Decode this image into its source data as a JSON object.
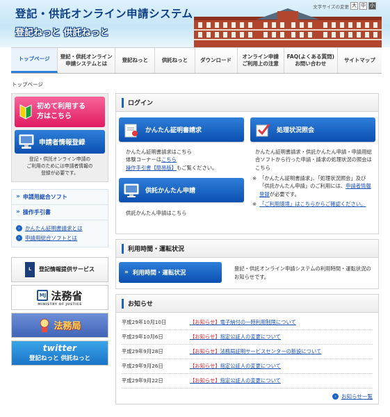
{
  "header": {
    "title": "登記・供託オンライン申請システム",
    "subtitle": "登記ねっと 供託ねっと",
    "font_size_label": "文字サイズの変更",
    "font_sizes": [
      "大",
      "中",
      "小"
    ]
  },
  "nav": {
    "items": [
      {
        "label": "トップページ"
      },
      {
        "label": "登記・供託オンライン\n申請システムとは"
      },
      {
        "label": "登記ねっと"
      },
      {
        "label": "供託ねっと"
      },
      {
        "label": "ダウンロード"
      },
      {
        "label": "オンライン申請\nご利用上の注意"
      },
      {
        "label": "FAQ(よくある質問)\nお問い合わせ"
      },
      {
        "label": "サイトマップ"
      }
    ]
  },
  "breadcrumb": "トップページ",
  "sidebar": {
    "first_use_button": "初めて利用する\n方はこちら",
    "register_button": "申請者情報登録",
    "register_note": "登記・供託オンライン申請の\nご利用のためには申請者情報の\n登録が必要です。",
    "sub_links": [
      "申請用総合ソフト",
      "操作手引書"
    ],
    "circle_links": [
      "かんたん証明書請求とは",
      "申請用総合ソフトとは"
    ],
    "banners": {
      "toukikyo": "登記情報提供サービス",
      "moj": "法務省",
      "moj_sub": "MINISTRY OF JUSTICE",
      "homukyoku": "法務局",
      "twitter_title": "twitter",
      "twitter_sub": "登記ねっと 供託ねっと"
    }
  },
  "login": {
    "heading": "ログイン",
    "btn_certificate": "かんたん証明書請求",
    "btn_status": "処理状況照会",
    "btn_kyotaku": "供託かんたん申請",
    "certificate_desc_1": "かんたん証明書請求はこちら",
    "certificate_desc_2a": "体験コーナーは",
    "certificate_desc_2b": "こちら",
    "certificate_desc_3a": "操作手引書【簡易版】",
    "certificate_desc_3b": "もご覧ください。",
    "status_desc": "かんたん証明書請求・供託かんたん申請・申請用総合ソフトから行った申請・請求の処理状況の照会はこちら",
    "note1_a": "「かんたん証明書請求」、「処理状況照会」及び「供託かんたん申請」のご利用には、",
    "note1_link": "申請者情報登録",
    "note1_b": "が必要です。",
    "note2_link": "「ご利用環境」はこちらからご確認ください。",
    "kyotaku_desc": "供託かんたん申請はこちら"
  },
  "status_panel": {
    "heading": "利用時間・運転状況",
    "button": "利用時間・運転状況",
    "desc": "登記・供託オンライン申請システムの利用時間・運転状況のお知らせです。"
  },
  "notices": {
    "heading": "お知らせ",
    "tag": "【お知らせ】",
    "items": [
      {
        "date": "平成29年10月10日",
        "title": "電子納付の一時利用制限について"
      },
      {
        "date": "平成29年10月6日",
        "title": "指定公証人の変更について"
      },
      {
        "date": "平成29年9月28日",
        "title": "法務局証明サービスセンターの新設について"
      },
      {
        "date": "平成29年9月26日",
        "title": "指定公証人の変更について"
      },
      {
        "date": "平成29年9月22日",
        "title": "指定公証人の変更について"
      }
    ],
    "more": "お知らせ一覧"
  },
  "colors": {
    "accent_blue": "#1a63c6",
    "pink": "#e01a62",
    "notice_red": "#d0212a"
  }
}
